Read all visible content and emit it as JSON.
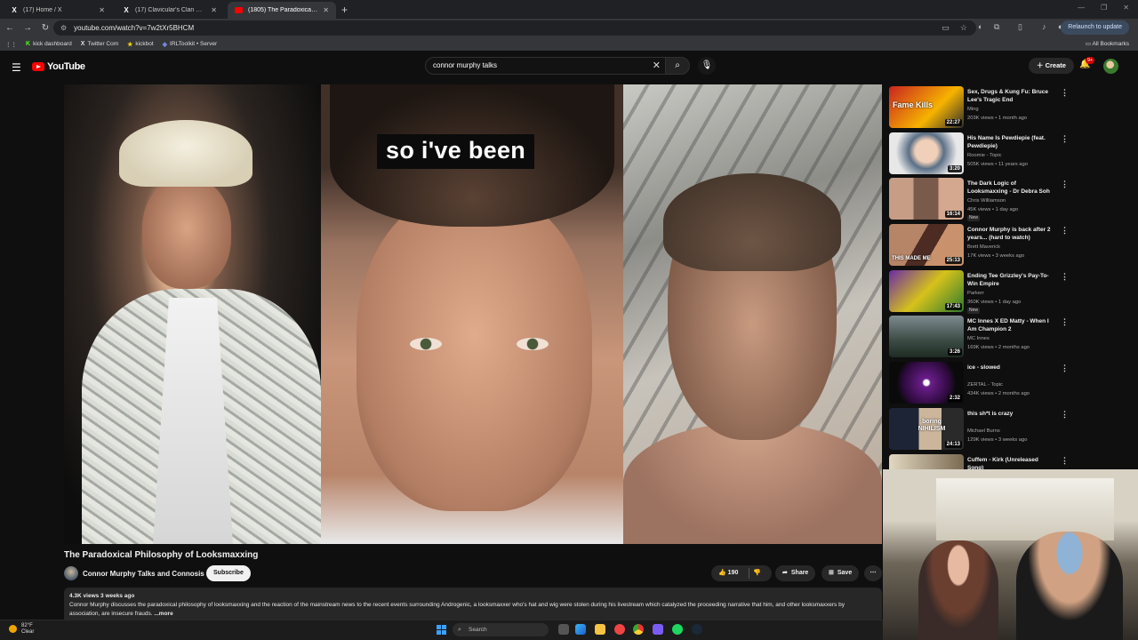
{
  "browser": {
    "tabs": [
      {
        "favicon": "X",
        "label": "(17) Home / X",
        "active": false
      },
      {
        "favicon": "X",
        "label": "(17) Clavicular's Clan Commun...",
        "active": false
      },
      {
        "favicon": "yt",
        "label": "(1805) The Paradoxical Philoso...",
        "active": true
      }
    ],
    "new_tab": "+",
    "url": "youtube.com/watch?v=7w2tXr5BHCM",
    "relaunch_label": "Relaunch to update",
    "bookmarks": [
      {
        "icon": "kick-icon",
        "label": "kick dashboard"
      },
      {
        "icon": "x-icon",
        "label": "Twitter Com"
      },
      {
        "icon": "kickbot-icon",
        "label": "kickbot"
      },
      {
        "icon": "irl-icon",
        "label": "IRLToolkit • Server"
      }
    ],
    "all_bookmarks": "All Bookmarks"
  },
  "youtube": {
    "logo_text": "YouTube",
    "search_query": "connor murphy talks",
    "create_label": "Create",
    "notifications_badge": "9+"
  },
  "video": {
    "caption": "so i've been",
    "title": "The Paradoxical Philosophy of Looksmaxxing",
    "channel": "Connor Murphy Talks and Connosis",
    "subscribe_label": "Subscribe",
    "likes": "190",
    "share_label": "Share",
    "save_label": "Save",
    "stats": "4.3K views  3 weeks ago",
    "description": "Connor Murphy discusses the paradoxical philosophy of looksmaxxing and the reaction of the mainstream news to the recent events surrounding Androgenic, a looksmaxxer who's hat and wig were stolen during his livestream which catalyzed the proceeding narrative that him, and other looksmaxxers by association, are insecure frauds.",
    "more_label": "...more"
  },
  "recommendations": [
    {
      "title": "Sex, Drugs & Kung Fu: Bruce Lee's Tragic End",
      "channel": "Ming",
      "views": "203K views • 1 month ago",
      "duration": "22:27",
      "thumb_text": "Fame  Kills",
      "new": false
    },
    {
      "title": "His Name Is Pewdiepie (feat. Pewdiepie)",
      "channel": "Roomie - Topic",
      "views": "505K views • 11 years ago",
      "duration": "3:20",
      "thumb_text": "",
      "new": false
    },
    {
      "title": "The Dark Logic of Looksmaxxing - Dr Debra Soh",
      "channel": "Chris Williamson",
      "views": "45K views • 1 day ago",
      "duration": "16:14",
      "thumb_text": "",
      "new": true
    },
    {
      "title": "Connor Murphy is back after 2 years... (hard to watch)",
      "channel": "Brett Maverick",
      "views": "17K views • 3 weeks ago",
      "duration": "25:13",
      "thumb_text": "THIS MADE ME",
      "new": false
    },
    {
      "title": "Ending Tee Grizzley's Pay-To-Win Empire",
      "channel": "Parkerr",
      "views": "360K views • 1 day ago",
      "duration": "17:43",
      "thumb_text": "",
      "new": true
    },
    {
      "title": "MC Innes X ED Matty - When I Am Champion 2",
      "channel": "MC Innes",
      "views": "169K views • 2 months ago",
      "duration": "3:26",
      "thumb_text": "",
      "new": false
    },
    {
      "title": "ice - slowed",
      "channel": "ZERTAL - Topic",
      "views": "434K views • 2 months ago",
      "duration": "2:32",
      "thumb_text": "",
      "new": false
    },
    {
      "title": "this sh*t is crazy",
      "channel": "Michael Burns",
      "views": "129K views • 3 weeks ago",
      "duration": "24:13",
      "thumb_text": "boring NIHILISM",
      "new": false
    },
    {
      "title": "Cuffem - Kirk (Unreleased Song)",
      "channel": "",
      "views": "",
      "duration": "",
      "thumb_text": "",
      "new": false
    }
  ],
  "new_badge": "New",
  "taskbar": {
    "temperature": "82°F",
    "condition": "Clear",
    "weather_badge": "2",
    "search_placeholder": "Search"
  }
}
